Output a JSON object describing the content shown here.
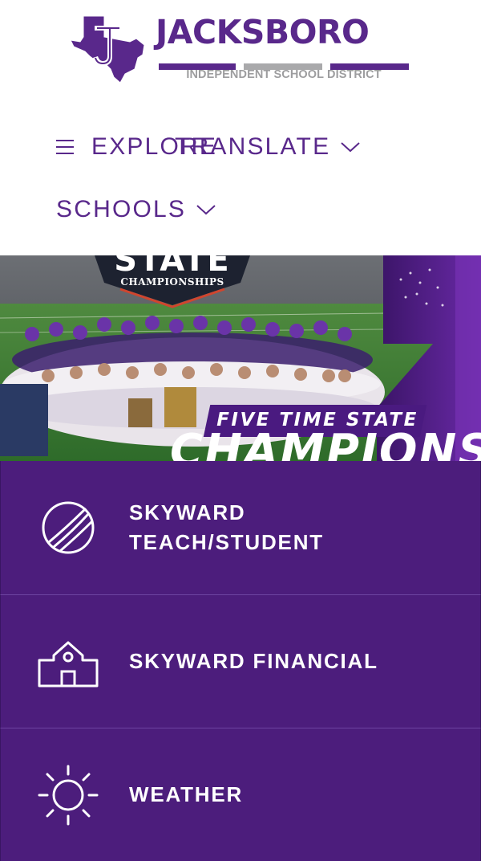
{
  "header": {
    "logo_mark_letter": "J",
    "logo_name": "JACKSBORO",
    "logo_district": "INDEPENDENT SCHOOL DISTRICT"
  },
  "nav": {
    "explore_label": "EXPLORE",
    "translate_label": "TRANSLATE",
    "schools_label": "SCHOOLS",
    "icons": {
      "menu": "hamburger-icon",
      "dropdown": "chevron-down-icon"
    }
  },
  "hero": {
    "badge_title": "STATE",
    "badge_subtitle": "CHAMPIONSHIPS",
    "caption": "FIVE TIME STATE",
    "headline": "CHAMPIONS"
  },
  "quick_links": [
    {
      "label_line1": "SKYWARD",
      "label_line2": "TEACH/STUDENT",
      "icon": "globe-icon"
    },
    {
      "label_line1": "SKYWARD FINANCIAL",
      "icon": "school-building-icon"
    },
    {
      "label_line1": "WEATHER",
      "icon": "sun-icon"
    }
  ],
  "colors": {
    "brand_purple": "#59288b",
    "panel_purple": "#4c1d7c",
    "logo_gray": "#a9a9ab"
  }
}
